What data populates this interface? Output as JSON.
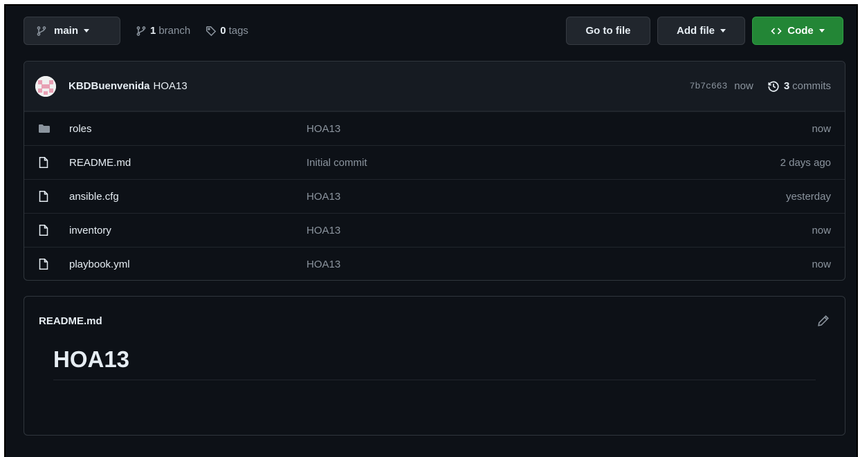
{
  "topbar": {
    "branch_name": "main",
    "branch_count": "1",
    "branch_label": "branch",
    "tag_count": "0",
    "tag_label": "tags",
    "go_to_file": "Go to file",
    "add_file": "Add file",
    "code": "Code"
  },
  "commit": {
    "author": "KBDBuenvenida",
    "message": "HOA13",
    "sha": "7b7c663",
    "time": "now",
    "commit_count": "3",
    "commit_label": "commits"
  },
  "files": [
    {
      "type": "folder",
      "name": "roles",
      "message": "HOA13",
      "age": "now"
    },
    {
      "type": "file",
      "name": "README.md",
      "message": "Initial commit",
      "age": "2 days ago"
    },
    {
      "type": "file",
      "name": "ansible.cfg",
      "message": "HOA13",
      "age": "yesterday"
    },
    {
      "type": "file",
      "name": "inventory",
      "message": "HOA13",
      "age": "now"
    },
    {
      "type": "file",
      "name": "playbook.yml",
      "message": "HOA13",
      "age": "now"
    }
  ],
  "readme": {
    "title": "README.md",
    "heading": "HOA13"
  },
  "colors": {
    "background": "#0d1117",
    "panel": "#161b22",
    "border": "#30363d",
    "code_button": "#238636",
    "muted_text": "#8b949e",
    "folder_icon": "#8b949e"
  }
}
